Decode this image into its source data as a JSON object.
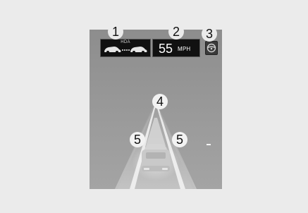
{
  "hud": {
    "hda_label": "HDA",
    "speed_value": "55",
    "speed_unit": "MPH"
  },
  "icons": {
    "hda": "car-pair-icon",
    "steering": "steering-wheel-icon",
    "lead_vehicle": "car-rear-icon"
  },
  "callouts": {
    "one": "1",
    "two": "2",
    "three": "3",
    "four": "4",
    "five_left": "5",
    "five_right": "5"
  },
  "colors": {
    "background": "#ebebeb",
    "display": "#9a9a9a",
    "hud_box": "#111111",
    "lane_line": "#f4f4f4"
  }
}
